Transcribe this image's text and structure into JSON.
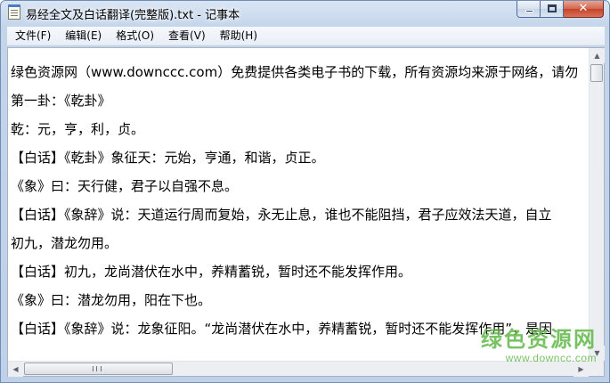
{
  "window": {
    "title": "易经全文及白话翻译(完整版).txt - 记事本",
    "close_glyph": "✕"
  },
  "menu": {
    "items": [
      {
        "label": "文件(F)"
      },
      {
        "label": "编辑(E)"
      },
      {
        "label": "格式(O)"
      },
      {
        "label": "查看(V)"
      },
      {
        "label": "帮助(H)"
      }
    ]
  },
  "document": {
    "lines": [
      "绿色资源网（www.downccc.com）免费提供各类电子书的下载，所有资源均来源于网络，请勿",
      "第一卦：《乾卦》",
      "乾：元，亨，利，贞。",
      "【白话】《乾卦》象征天：元始，亨通，和谐，贞正。",
      "《象》曰：天行健，君子以自强不息。",
      "【白话】《象辞》说：天道运行周而复始，永无止息，谁也不能阻挡，君子应效法天道，自立",
      "初九，潜龙勿用。",
      "【白话】初九，龙尚潜伏在水中，养精蓄锐，暂时还不能发挥作用。",
      "《象》曰：潜龙勿用，阳在下也。",
      "【白话】《象辞》说：龙象征阳。“龙尚潜伏在水中，养精蓄锐，暂时还不能发挥作用”，是因"
    ]
  },
  "scrollbars": {
    "up_arrow": "▲",
    "down_arrow": "▼",
    "left_arrow": "◀",
    "right_arrow": "▶"
  },
  "watermark": {
    "title": "绿色资源网",
    "url": "www.downcc.com"
  }
}
